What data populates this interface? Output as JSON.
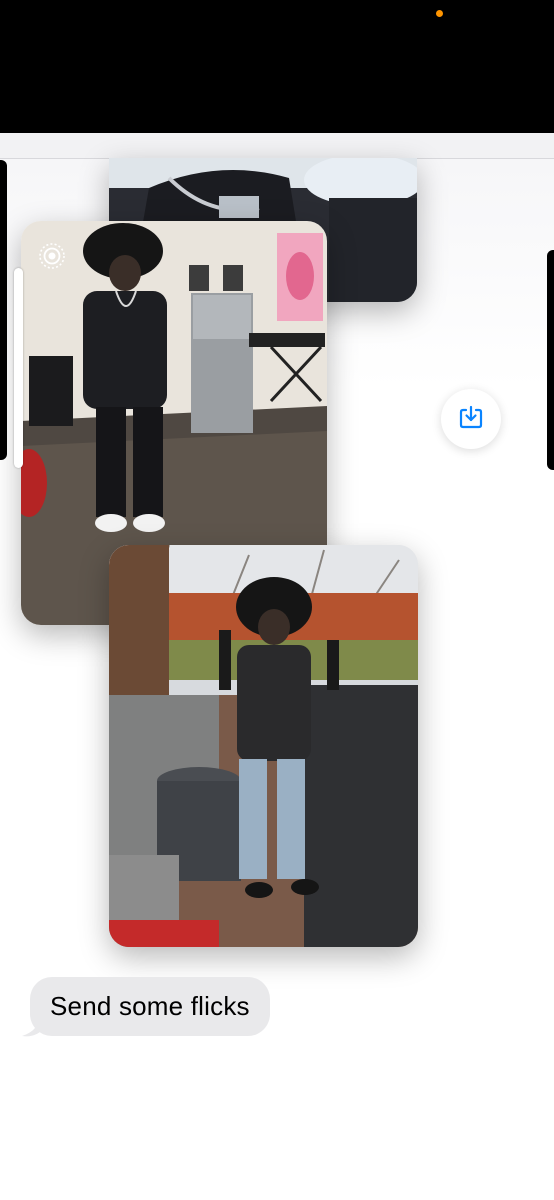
{
  "status_bar": {
    "indicator_color": "#ff9500"
  },
  "photos": [
    {
      "icon": "photo-partial"
    },
    {
      "icon": "photo-indoor",
      "badge_icon": "live-photo-icon"
    },
    {
      "icon": "photo-outdoor"
    }
  ],
  "actions": {
    "save_icon": "download-tray-icon",
    "accent": "#0a84ff"
  },
  "messages": [
    {
      "text": "Send some flicks",
      "direction": "incoming",
      "bubble_color": "#e9e9eb"
    }
  ]
}
